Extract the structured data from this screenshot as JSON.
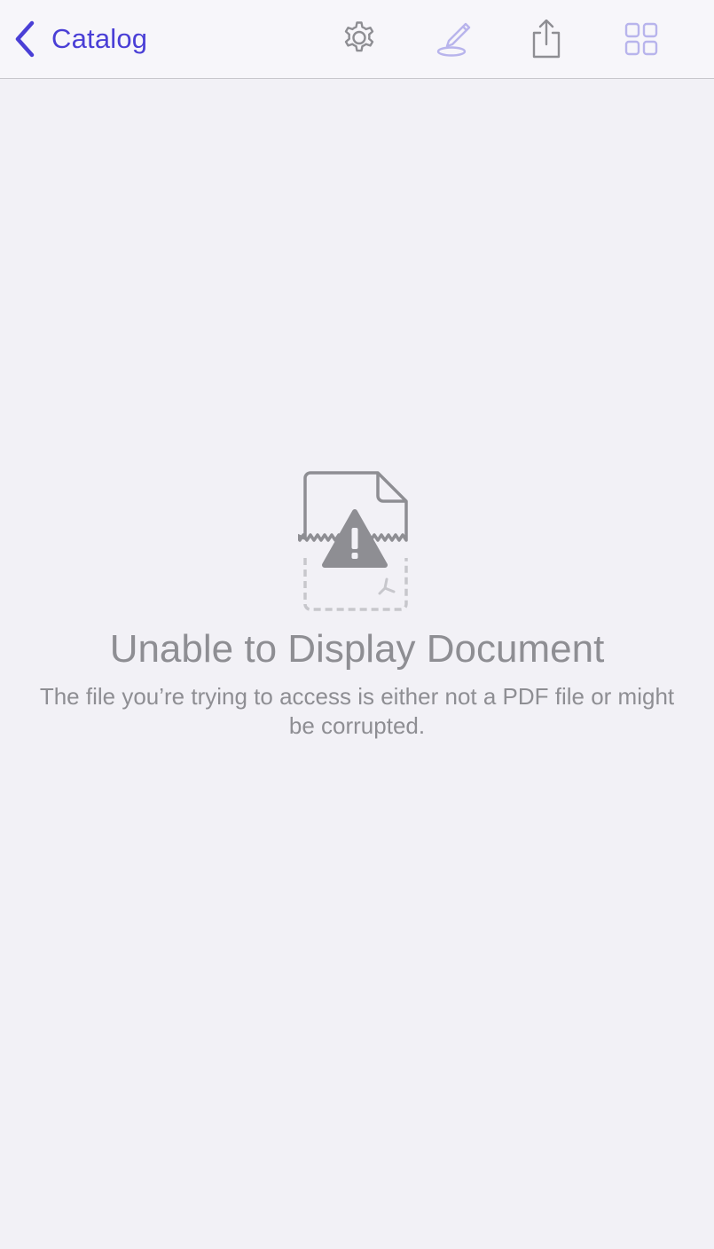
{
  "navbar": {
    "back_label": "Catalog",
    "icons": {
      "back": "chevron-left-icon",
      "settings": "gear-icon",
      "annotate": "pen-icon",
      "share": "share-icon",
      "thumbnails": "grid-icon"
    }
  },
  "error": {
    "icon": "broken-document-icon",
    "title": "Unable to Display Document",
    "message": "The file you’re trying to access is either not a PDF file or might be corrupted."
  },
  "colors": {
    "accent": "#4a3fd6",
    "accent_disabled": "#b8b4ec",
    "icon_gray": "#8e8e93",
    "background": "#f2f1f6",
    "navbar_background": "#f7f6fa"
  }
}
